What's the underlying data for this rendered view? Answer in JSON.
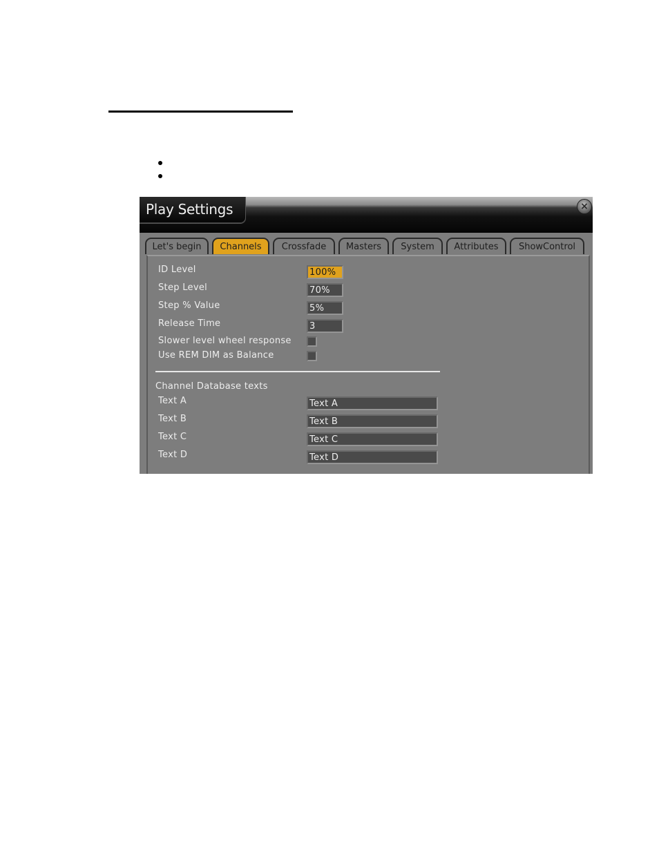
{
  "document": {
    "bullets": [
      "",
      ""
    ]
  },
  "window": {
    "title": "Play Settings",
    "close_icon": "close-x-icon",
    "tabs": [
      {
        "label": "Let's begin",
        "active": false
      },
      {
        "label": "Channels",
        "active": true
      },
      {
        "label": "Crossfade",
        "active": false
      },
      {
        "label": "Masters",
        "active": false
      },
      {
        "label": "System",
        "active": false
      },
      {
        "label": "Attributes",
        "active": false
      },
      {
        "label": "ShowControl",
        "active": false
      }
    ],
    "settings": [
      {
        "label": "ID Level",
        "value": "100%",
        "type": "field",
        "highlighted": true
      },
      {
        "label": "Step Level",
        "value": "70%",
        "type": "field"
      },
      {
        "label": "Step % Value",
        "value": "5%",
        "type": "field"
      },
      {
        "label": "Release Time",
        "value": "3",
        "type": "field"
      },
      {
        "label": "Slower level wheel response",
        "checked": false,
        "type": "checkbox"
      },
      {
        "label": "Use REM DIM as Balance",
        "checked": false,
        "type": "checkbox"
      }
    ],
    "database_section": {
      "heading": "Channel Database texts",
      "rows": [
        {
          "label": "Text A",
          "value": "Text A"
        },
        {
          "label": "Text B",
          "value": "Text B"
        },
        {
          "label": "Text C",
          "value": "Text C"
        },
        {
          "label": "Text D",
          "value": "Text D"
        }
      ]
    },
    "colors": {
      "accent": "#e0a21d",
      "panel": "#7d7d7d",
      "field": "#4a4a4a"
    }
  }
}
